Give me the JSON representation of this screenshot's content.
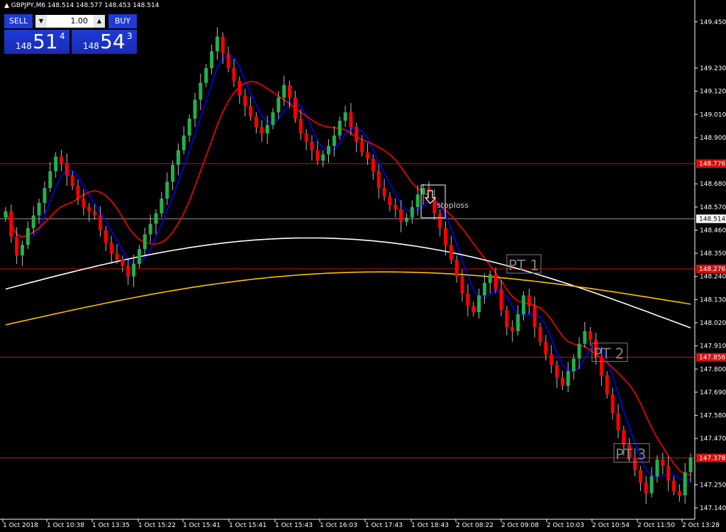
{
  "window": {
    "symbol_line": "GBPJPY,M6  148.514 148.577 148.453 148.514"
  },
  "trade_panel": {
    "sell_label": "SELL",
    "buy_label": "BUY",
    "lot_value": "1.00",
    "sell_small": "148",
    "sell_big": "51",
    "sell_sup": "4",
    "buy_small": "148",
    "buy_big": "54",
    "buy_sup": "3"
  },
  "colors": {
    "background": "#000000",
    "bull": "#22b14c",
    "bear": "#ff0000",
    "ma_fast": "#0000ff",
    "ma_mid": "#ff0000",
    "ma_slow": "#ffffff",
    "ma_slowest": "#ffc000",
    "hline": "#d01010",
    "price_line": "#8c8c8c",
    "axis_text": "#ffffff"
  },
  "chart_data": {
    "type": "candlestick",
    "y_axis_ticks": [
      "149.450",
      "149.230",
      "149.120",
      "149.010",
      "148.900",
      "148.680",
      "148.570",
      "148.460",
      "148.350",
      "148.240",
      "148.130",
      "148.020",
      "147.910",
      "147.800",
      "147.690",
      "147.580",
      "147.470",
      "147.250",
      "147.140"
    ],
    "x_axis_ticks": [
      "1 Oct 2018",
      "1 Oct 10:38",
      "1 Oct 13:35",
      "1 Oct 15:22",
      "1 Oct 15:41",
      "1 Oct 15:41",
      "1 Oct 15:43",
      "1 Oct 16:03",
      "1 Oct 17:43",
      "1 Oct 18:43",
      "2 Oct 08:22",
      "2 Oct 09:08",
      "2 Oct 10:03",
      "2 Oct 10:54",
      "2 Oct 11:50",
      "2 Oct 13:28"
    ],
    "ylim": [
      147.12,
      149.52
    ],
    "current_price": "148.514",
    "current_price_value": 148.514,
    "horizontal_lines": [
      {
        "label": "148.776",
        "value": 148.776
      },
      {
        "label": "148.276",
        "value": 148.276
      },
      {
        "label": "147.856",
        "value": 147.856
      },
      {
        "label": "147.378",
        "value": 147.378
      }
    ],
    "annotations": [
      {
        "text": "PT 1",
        "value": 148.276
      },
      {
        "text": "PT 2",
        "value": 147.856
      },
      {
        "text": "PT 3",
        "value": 147.378
      },
      {
        "text": "stoploss",
        "value": 148.58
      }
    ],
    "closes": [
      148.55,
      148.43,
      148.34,
      148.39,
      148.47,
      148.53,
      148.59,
      148.66,
      148.74,
      148.81,
      148.78,
      148.72,
      148.67,
      148.61,
      148.57,
      148.55,
      148.53,
      148.46,
      148.4,
      148.35,
      148.32,
      148.29,
      148.24,
      148.3,
      148.37,
      148.44,
      148.49,
      148.54,
      148.61,
      148.69,
      148.77,
      148.84,
      148.91,
      148.99,
      149.08,
      149.16,
      149.23,
      149.31,
      149.38,
      149.3,
      149.23,
      149.17,
      149.1,
      149.05,
      149.0,
      148.95,
      148.92,
      148.96,
      149.02,
      149.09,
      149.15,
      149.09,
      148.99,
      148.92,
      148.88,
      148.84,
      148.79,
      148.82,
      148.86,
      148.91,
      148.98,
      149.02,
      148.95,
      148.88,
      148.83,
      148.8,
      148.74,
      148.66,
      148.62,
      148.58,
      148.56,
      148.5,
      148.52,
      148.57,
      148.63,
      148.66,
      148.61,
      148.54,
      148.47,
      148.39,
      148.32,
      148.24,
      148.16,
      148.1,
      148.07,
      148.15,
      148.21,
      148.25,
      148.18,
      148.08,
      148.0,
      147.98,
      148.06,
      148.15,
      148.1,
      148.0,
      147.93,
      147.87,
      147.82,
      147.76,
      147.72,
      147.79,
      147.85,
      147.92,
      147.98,
      147.94,
      147.86,
      147.77,
      147.68,
      147.59,
      147.51,
      147.44,
      147.38,
      147.32,
      147.26,
      147.21,
      147.29,
      147.37,
      147.34,
      147.27,
      147.22,
      147.2,
      147.31,
      147.38
    ]
  }
}
